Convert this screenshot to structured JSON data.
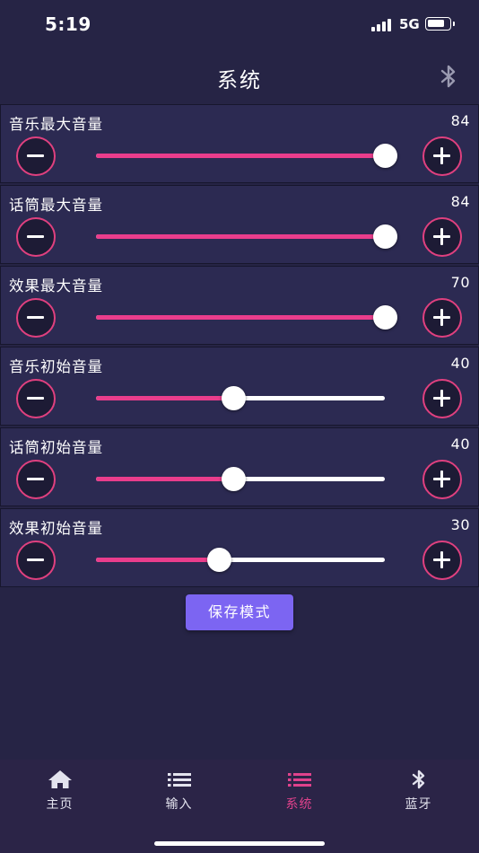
{
  "status_bar": {
    "time": "5:19",
    "network": "5G",
    "battery_level": 0.8
  },
  "nav": {
    "title": "系统",
    "right_icon": "bluetooth-icon"
  },
  "sliders": [
    {
      "label": "音乐最大音量",
      "value": "84",
      "fill": 1.0
    },
    {
      "label": "话筒最大音量",
      "value": "84",
      "fill": 1.0
    },
    {
      "label": "效果最大音量",
      "value": "70",
      "fill": 1.0
    },
    {
      "label": "音乐初始音量",
      "value": "40",
      "fill": 0.476
    },
    {
      "label": "话筒初始音量",
      "value": "40",
      "fill": 0.476
    },
    {
      "label": "效果初始音量",
      "value": "30",
      "fill": 0.427
    }
  ],
  "save_label": "保存模式",
  "tabs": [
    {
      "label": "主页",
      "icon": "home-icon",
      "active": false
    },
    {
      "label": "输入",
      "icon": "list-icon",
      "active": false
    },
    {
      "label": "系统",
      "icon": "list-icon",
      "active": true
    },
    {
      "label": "蓝牙",
      "icon": "bluetooth-icon",
      "active": false
    }
  ],
  "colors": {
    "accent_pink": "#ea3d8c",
    "button_purple": "#7c65f2",
    "background": "#262445",
    "row_background": "#2c2a52"
  }
}
